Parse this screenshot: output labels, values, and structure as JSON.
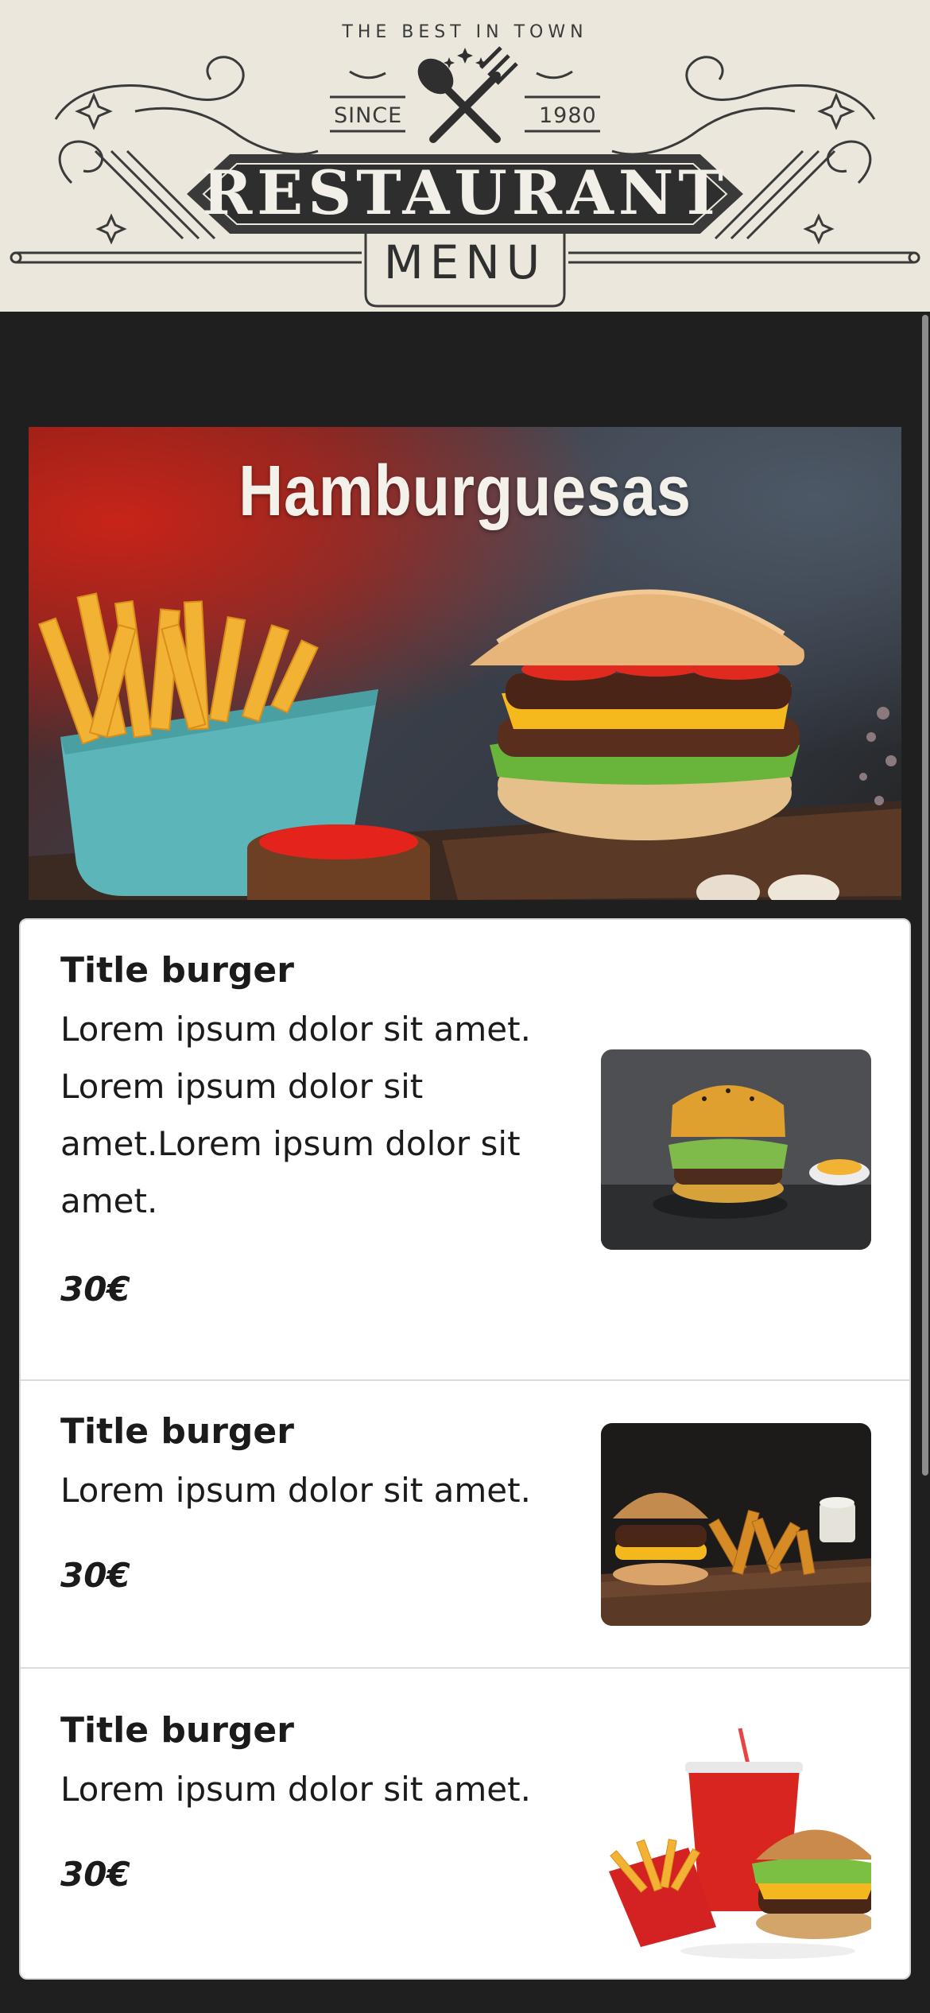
{
  "header": {
    "tagline": "THE BEST IN TOWN",
    "since_label": "SINCE",
    "year": "1980",
    "restaurant": "RESTAURANT",
    "menu": "MENU",
    "logo_icon": "fork-and-spoon-icon"
  },
  "banner": {
    "title": "Hamburguesas"
  },
  "items": [
    {
      "title": "Title burger",
      "description": "Lorem ipsum dolor sit amet. Lorem ipsum dolor sit amet.Lorem ipsum dolor sit amet.",
      "price": "30€"
    },
    {
      "title": "Title burger",
      "description": "Lorem ipsum dolor sit amet.",
      "price": "30€"
    },
    {
      "title": "Title burger",
      "description": "Lorem ipsum dolor sit amet.",
      "price": "30€"
    }
  ],
  "colors": {
    "background": "#1f1f1f",
    "header_bg": "#ebe7dc",
    "card_bg": "#ffffff",
    "text": "#1b1b1b"
  }
}
